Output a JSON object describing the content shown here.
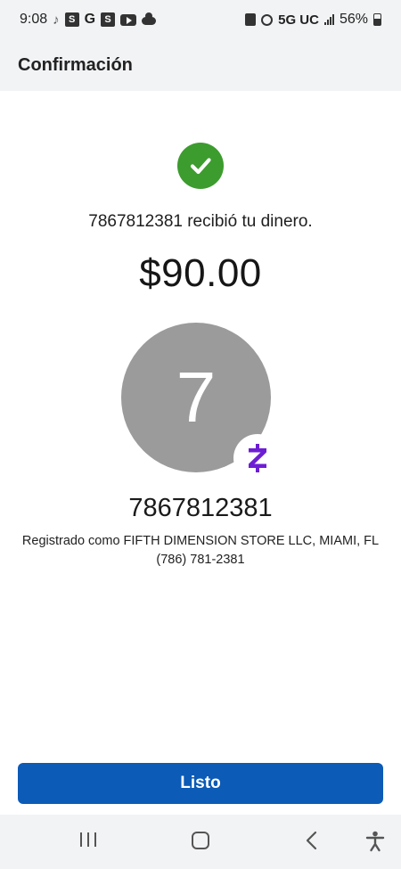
{
  "status_bar": {
    "time": "9:08",
    "network": "5G UC",
    "battery_percent": "56%",
    "icons": [
      "tiktok-icon",
      "s-app-icon",
      "google-icon",
      "s-app-icon",
      "youtube-icon",
      "cloud-icon",
      "battery-saver-icon",
      "alarm-icon",
      "signal-icon",
      "battery-icon"
    ]
  },
  "header": {
    "title": "Confirmación"
  },
  "confirmation": {
    "status_icon": "check-circle-icon",
    "received_text": "7867812381 recibió tu dinero.",
    "amount": "$90.00"
  },
  "recipient": {
    "avatar_letter": "7",
    "badge_icon": "zelle-icon",
    "number": "7867812381",
    "registered_line": "Registrado como FIFTH DIMENSION STORE LLC, MIAMI, FL",
    "phone": "(786) 781-2381"
  },
  "actions": {
    "done_label": "Listo"
  },
  "nav": {
    "icons": [
      "recent-apps-icon",
      "home-icon",
      "back-icon",
      "accessibility-icon"
    ]
  },
  "colors": {
    "success": "#3c9c2e",
    "primary_button": "#0b5bb7",
    "zelle_purple": "#6d1ed4",
    "avatar_gray": "#9b9b9b"
  }
}
